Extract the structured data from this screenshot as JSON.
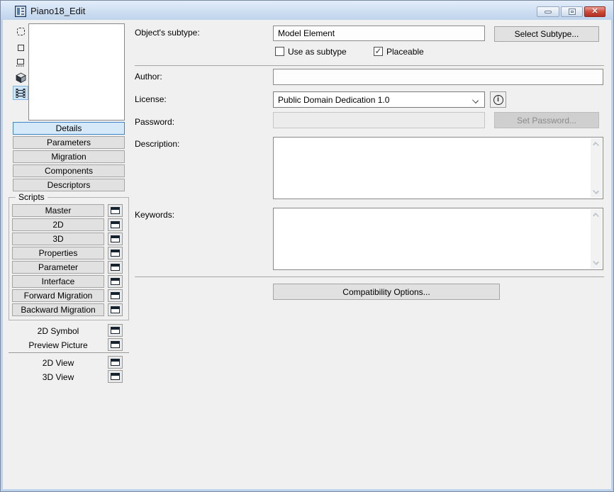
{
  "window": {
    "title": "Piano18_Edit",
    "caption_buttons": {
      "minimize": "minimize",
      "maximize": "maximize",
      "close_glyph": "✕"
    }
  },
  "colors": {
    "accent_selected_border": "#3b86c8",
    "accent_selected_fill": "#d6e9f9",
    "close_button_red": "#b13022",
    "titlebar_blue": "#cdddf1",
    "client_background": "#f0f0f0"
  },
  "left_panel": {
    "view_icons": [
      {
        "name": "symbol-2d-icon"
      },
      {
        "name": "plain-2d-icon"
      },
      {
        "name": "front-view-icon"
      },
      {
        "name": "cube-3d-icon"
      },
      {
        "name": "filmstrip-script-icon",
        "selected": true
      }
    ],
    "section_buttons": [
      "Details",
      "Parameters",
      "Migration",
      "Components",
      "Descriptors"
    ],
    "selected_section": "Details",
    "scripts_group_label": "Scripts",
    "script_buttons": [
      "Master",
      "2D",
      "3D",
      "Properties",
      "Parameter",
      "Interface",
      "Forward Migration",
      "Backward Migration"
    ],
    "symbol_rows": [
      "2D Symbol",
      "Preview Picture"
    ],
    "view_rows": [
      "2D View",
      "3D View"
    ]
  },
  "form": {
    "subtype_label": "Object's subtype:",
    "subtype_value": "Model Element",
    "select_subtype_button": "Select Subtype...",
    "use_as_subtype_label": "Use as subtype",
    "use_as_subtype_checked": false,
    "placeable_label": "Placeable",
    "placeable_checked": true,
    "author_label": "Author:",
    "author_value": "",
    "license_label": "License:",
    "license_value": "Public Domain Dedication 1.0",
    "password_label": "Password:",
    "password_value": "",
    "set_password_button": "Set Password...",
    "set_password_enabled": false,
    "description_label": "Description:",
    "description_value": "",
    "keywords_label": "Keywords:",
    "keywords_value": "",
    "compatibility_button": "Compatibility Options..."
  },
  "glyphs": {
    "check": "✓"
  }
}
